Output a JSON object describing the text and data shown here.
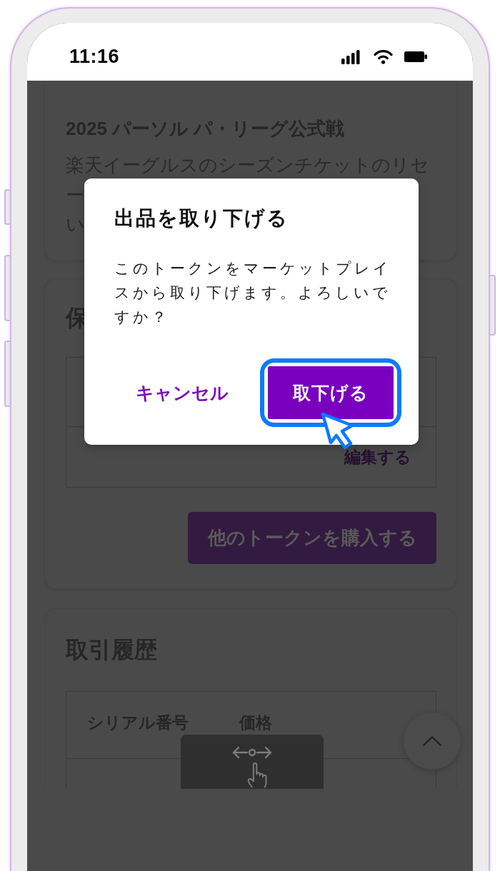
{
  "status_bar": {
    "time": "11:16"
  },
  "cards": [
    {
      "kind": "event",
      "title": "2025 パーソル パ・リーグ公式戦",
      "description_lines": [
        "楽天イーグルスのシーズンチケットのリセ",
        "ー",
        "い"
      ]
    },
    {
      "kind": "holdings",
      "title": "保",
      "table": {
        "action": "編集する"
      },
      "button": "他のトークンを購入する"
    },
    {
      "kind": "history",
      "title": "取引履歴",
      "table": {
        "columns": [
          "シリアル番号",
          "価格"
        ]
      }
    }
  ],
  "dialog": {
    "title": "出品を取り下げる",
    "message": "このトークンをマーケットプレイスから取り下げます。よろしいですか？",
    "buttons": [
      {
        "label": "キャンセル",
        "kind": "text",
        "focused": false
      },
      {
        "label": "取下げる",
        "kind": "primary",
        "focused": true
      }
    ]
  }
}
